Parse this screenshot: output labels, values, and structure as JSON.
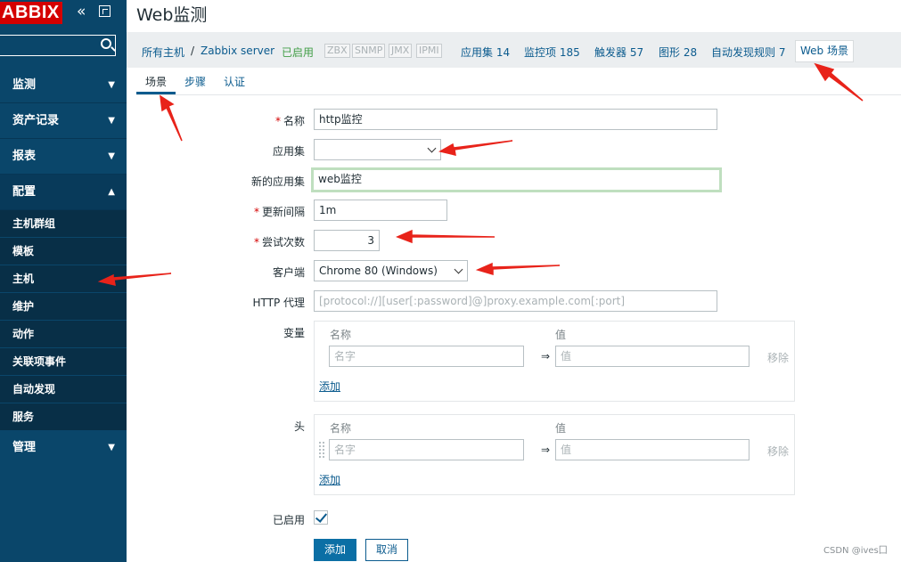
{
  "sidebar": {
    "logo": "ABBIX",
    "search_placeholder": "",
    "menu": [
      {
        "label": "监测",
        "chevron": "⌄"
      },
      {
        "label": "资产记录",
        "chevron": "⌄"
      },
      {
        "label": "报表",
        "chevron": "⌄"
      },
      {
        "label": "配置",
        "chevron": "⌃"
      }
    ],
    "config_items": [
      "主机群组",
      "模板",
      "主机",
      "维护",
      "动作",
      "关联项事件",
      "自动发现",
      "服务"
    ],
    "admin": {
      "label": "管理",
      "chevron": "⌄"
    }
  },
  "header": {
    "title": "Web监测",
    "breadcrumb": {
      "all_hosts": "所有主机",
      "sep": "/",
      "host": "Zabbix server"
    },
    "status": "已启用",
    "protocols": [
      "ZBX",
      "SNMP",
      "JMX",
      "IPMI"
    ],
    "links": {
      "applications": "应用集 14",
      "items": "监控项 185",
      "triggers": "触发器 57",
      "graphs": "图形 28",
      "discovery": "自动发现规则 7",
      "web": "Web 场景"
    }
  },
  "tabs": {
    "scenario": "场景",
    "steps": "步骤",
    "auth": "认证"
  },
  "form": {
    "name_label": "名称",
    "name_value": "http监控",
    "application_label": "应用集",
    "application_value": "",
    "new_application_label": "新的应用集",
    "new_application_value": "web监控",
    "interval_label": "更新间隔",
    "interval_value": "1m",
    "attempts_label": "尝试次数",
    "attempts_value": "3",
    "agent_label": "客户端",
    "agent_value": "Chrome 80 (Windows)",
    "proxy_label": "HTTP 代理",
    "proxy_placeholder": "[protocol://][user[:password]@]proxy.example.com[:port]",
    "variables_label": "变量",
    "headers_label": "头",
    "col_name": "名称",
    "col_value": "值",
    "name_placeholder": "名字",
    "value_placeholder": "值",
    "arrow": "⇒",
    "remove": "移除",
    "add_link": "添加",
    "enabled_label": "已启用",
    "enabled": true
  },
  "buttons": {
    "add": "添加",
    "cancel": "取消"
  },
  "watermark": "CSDN @ives囗",
  "colors": {
    "sidebar": "#0a466a",
    "logo": "#d40000",
    "accent": "#0b5b8e",
    "enabled": "#429e47",
    "annotation_arrow": "#e8231a"
  }
}
